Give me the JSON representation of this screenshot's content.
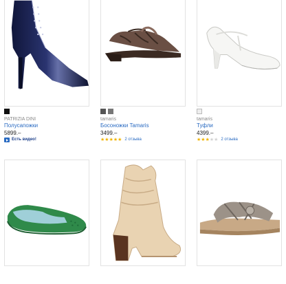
{
  "products": [
    {
      "brand": "PATRIZIA DINI",
      "name": "Полусапожки",
      "price": "5899.–",
      "video_label": "Есть видео!",
      "swatch_colors": [
        "#111111"
      ]
    },
    {
      "brand": "tamaris",
      "name": "Босоножки Tamaris",
      "price": "3499.–",
      "reviews": "2 отзыва",
      "rating": 5,
      "swatch_colors": [
        "#555555",
        "#777777"
      ]
    },
    {
      "brand": "tamaris",
      "name": "Туфли",
      "price": "4399.–",
      "reviews": "2 отзыва",
      "rating": 3,
      "swatch_colors": [
        "#eeeeee"
      ]
    }
  ],
  "icons": {
    "star": "★",
    "video": "video-icon"
  },
  "colors": {
    "link": "#2a6bc2",
    "star": "#f0b400",
    "star_off": "#d2d2d2",
    "border": "#e2e2e2"
  }
}
